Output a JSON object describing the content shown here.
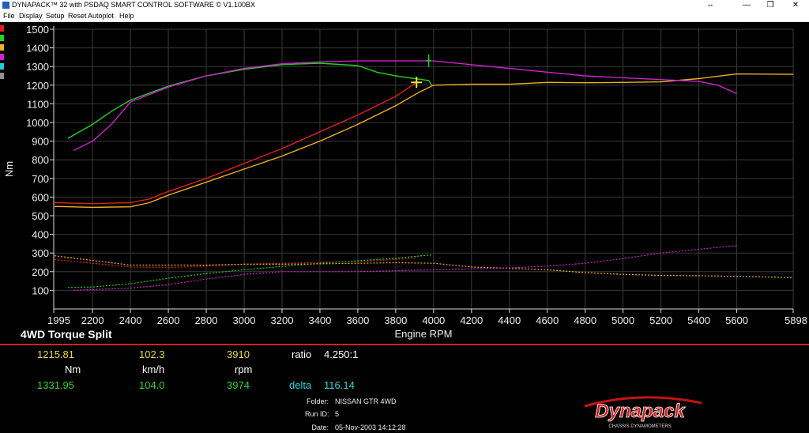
{
  "window": {
    "title": "DYNAPACK™ 32 with PSDAQ SMART CONTROL SOFTWARE © V1.100BX",
    "controls": [
      "⇔",
      "—",
      "❐",
      "✕"
    ]
  },
  "menu": [
    "File",
    "Display",
    "Setup",
    "Reset",
    "Autoplot",
    "Help"
  ],
  "legend_swatches": [
    "#e01e1e",
    "#1fd21f",
    "#f0b020",
    "#d020d0",
    "#20d0d0",
    "#909090"
  ],
  "chart_data": {
    "type": "line",
    "title": "4WD Torque Split",
    "xlabel": "Engine RPM",
    "ylabel": "Nm",
    "xlim": [
      1995,
      5898
    ],
    "ylim": [
      100,
      1500
    ],
    "x_ticks": [
      "1995",
      "2200",
      "2400",
      "2600",
      "2800",
      "3000",
      "3200",
      "3400",
      "3600",
      "3800",
      "4000",
      "4200",
      "4400",
      "4600",
      "4800",
      "5000",
      "5200",
      "5400",
      "5600",
      "5898"
    ],
    "y_ticks": [
      "100",
      "200",
      "300",
      "400",
      "500",
      "600",
      "700",
      "800",
      "900",
      "1000",
      "1100",
      "1200",
      "1300",
      "1400",
      "1500"
    ],
    "grid": true,
    "series": [
      {
        "color": "#e01e1e",
        "style": "solid",
        "points": [
          [
            2000,
            570
          ],
          [
            2200,
            565
          ],
          [
            2400,
            570
          ],
          [
            2500,
            590
          ],
          [
            2600,
            630
          ],
          [
            2800,
            700
          ],
          [
            3000,
            780
          ],
          [
            3200,
            860
          ],
          [
            3400,
            950
          ],
          [
            3600,
            1040
          ],
          [
            3800,
            1140
          ],
          [
            3910,
            1215
          ]
        ]
      },
      {
        "color": "#1fd21f",
        "style": "solid",
        "points": [
          [
            2070,
            915
          ],
          [
            2200,
            990
          ],
          [
            2300,
            1060
          ],
          [
            2400,
            1120
          ],
          [
            2600,
            1195
          ],
          [
            2800,
            1250
          ],
          [
            3000,
            1285
          ],
          [
            3200,
            1310
          ],
          [
            3400,
            1318
          ],
          [
            3600,
            1305
          ],
          [
            3700,
            1270
          ],
          [
            3800,
            1250
          ],
          [
            3974,
            1225
          ],
          [
            3990,
            1200
          ]
        ]
      },
      {
        "color": "#f0b020",
        "style": "solid",
        "points": [
          [
            2000,
            550
          ],
          [
            2200,
            545
          ],
          [
            2400,
            548
          ],
          [
            2500,
            570
          ],
          [
            2600,
            610
          ],
          [
            2800,
            680
          ],
          [
            3000,
            750
          ],
          [
            3200,
            820
          ],
          [
            3400,
            900
          ],
          [
            3600,
            990
          ],
          [
            3800,
            1090
          ],
          [
            3920,
            1160
          ],
          [
            4000,
            1200
          ],
          [
            4200,
            1205
          ],
          [
            4400,
            1205
          ],
          [
            4600,
            1215
          ],
          [
            4800,
            1213
          ],
          [
            5000,
            1215
          ],
          [
            5200,
            1218
          ],
          [
            5400,
            1235
          ],
          [
            5600,
            1260
          ],
          [
            5898,
            1258
          ]
        ]
      },
      {
        "color": "#d020d0",
        "style": "solid",
        "points": [
          [
            2100,
            850
          ],
          [
            2200,
            900
          ],
          [
            2300,
            990
          ],
          [
            2400,
            1110
          ],
          [
            2600,
            1190
          ],
          [
            2800,
            1250
          ],
          [
            3000,
            1290
          ],
          [
            3200,
            1315
          ],
          [
            3400,
            1325
          ],
          [
            3600,
            1330
          ],
          [
            3800,
            1330
          ],
          [
            4000,
            1330
          ],
          [
            4200,
            1310
          ],
          [
            4400,
            1290
          ],
          [
            4600,
            1270
          ],
          [
            4800,
            1250
          ],
          [
            5000,
            1240
          ],
          [
            5200,
            1230
          ],
          [
            5400,
            1220
          ],
          [
            5500,
            1200
          ],
          [
            5600,
            1155
          ]
        ]
      },
      {
        "color": "#e01e1e",
        "style": "dotted",
        "points": [
          [
            2000,
            265
          ],
          [
            2200,
            245
          ],
          [
            2400,
            225
          ],
          [
            2600,
            222
          ],
          [
            2800,
            230
          ],
          [
            3000,
            240
          ],
          [
            3200,
            245
          ],
          [
            3400,
            250
          ],
          [
            3600,
            255
          ],
          [
            3800,
            265
          ],
          [
            3910,
            275
          ]
        ]
      },
      {
        "color": "#1fd21f",
        "style": "dotted",
        "points": [
          [
            2070,
            115
          ],
          [
            2200,
            118
          ],
          [
            2400,
            135
          ],
          [
            2600,
            165
          ],
          [
            2800,
            190
          ],
          [
            3000,
            210
          ],
          [
            3200,
            228
          ],
          [
            3400,
            245
          ],
          [
            3600,
            258
          ],
          [
            3800,
            272
          ],
          [
            3990,
            290
          ]
        ]
      },
      {
        "color": "#f0b020",
        "style": "dotted",
        "points": [
          [
            2000,
            285
          ],
          [
            2200,
            260
          ],
          [
            2400,
            235
          ],
          [
            2600,
            235
          ],
          [
            2800,
            235
          ],
          [
            3000,
            240
          ],
          [
            3200,
            240
          ],
          [
            3400,
            242
          ],
          [
            3600,
            245
          ],
          [
            3800,
            248
          ],
          [
            4000,
            245
          ],
          [
            4200,
            225
          ],
          [
            4400,
            218
          ],
          [
            4600,
            210
          ],
          [
            4800,
            195
          ],
          [
            5000,
            185
          ],
          [
            5200,
            180
          ],
          [
            5400,
            178
          ],
          [
            5600,
            175
          ],
          [
            5898,
            168
          ]
        ]
      },
      {
        "color": "#d020d0",
        "style": "dotted",
        "points": [
          [
            2100,
            100
          ],
          [
            2400,
            112
          ],
          [
            2600,
            130
          ],
          [
            2800,
            160
          ],
          [
            3000,
            185
          ],
          [
            3200,
            200
          ],
          [
            3400,
            200
          ],
          [
            3600,
            200
          ],
          [
            3800,
            205
          ],
          [
            4000,
            210
          ],
          [
            4200,
            215
          ],
          [
            4400,
            220
          ],
          [
            4600,
            230
          ],
          [
            4800,
            245
          ],
          [
            5000,
            270
          ],
          [
            5200,
            300
          ],
          [
            5400,
            320
          ],
          [
            5500,
            330
          ],
          [
            5600,
            340
          ]
        ]
      }
    ],
    "markers": [
      {
        "color": "#f0e040",
        "x": 3910,
        "y": 1215,
        "style": "cross"
      },
      {
        "color": "#1fd21f",
        "x": 3974,
        "y": 1331.95,
        "style": "vbar"
      }
    ]
  },
  "readout": {
    "row1": {
      "torque": "1215.81",
      "speed": "102.3",
      "rpm": "3910",
      "ratio_label": "ratio",
      "ratio_value": "4.250:1"
    },
    "units": {
      "torque": "Nm",
      "speed": "km/h",
      "rpm": "rpm"
    },
    "row2": {
      "torque": "1331.95",
      "speed": "104.0",
      "rpm": "3974",
      "delta_label": "delta",
      "delta_value": "116.14"
    }
  },
  "info": {
    "folder_label": "Folder:",
    "folder": "NISSAN GTR 4WD",
    "runid_label": "Run ID:",
    "runid": "5",
    "date_label": "Date:",
    "date": "05-Nov-2003 14:12:28"
  },
  "logo": {
    "brand": "Dynapack",
    "tagline": "CHASSIS DYNAMOMETERS"
  }
}
